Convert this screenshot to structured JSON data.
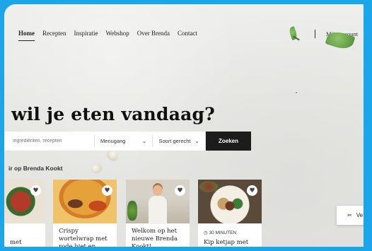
{
  "nav": {
    "items": [
      {
        "label": "Home",
        "active": true
      },
      {
        "label": "Recepten"
      },
      {
        "label": "Inspiratie"
      },
      {
        "label": "Webshop"
      },
      {
        "label": "Over Brenda"
      },
      {
        "label": "Contact"
      }
    ],
    "account_label": "Mijn account"
  },
  "hero": {
    "headline": "wil je eten vandaag?"
  },
  "search": {
    "placeholder": "ingrediënten, recepten",
    "course_label": "Menugang",
    "dish_type_label": "Soort gerecht",
    "submit_label": "Zoeken"
  },
  "section": {
    "title": "ir op Brenda Kookt"
  },
  "cards": [
    {
      "title": "met",
      "icon": "heart-icon"
    },
    {
      "title": "Crispy wortelwrap met rode biet en",
      "icon": "heart-icon"
    },
    {
      "title": "Welkom op het nieuwe Brenda Kookt!",
      "icon": "heart-icon"
    },
    {
      "meta": "30 MINUTEN",
      "title": "Kip ketjap met slirt en",
      "icon": "heart-icon"
    }
  ],
  "floating": {
    "label": "Ve",
    "icon": "utensils-icon"
  },
  "colors": {
    "frame": "#1aa6e8",
    "button_dark": "#1c1c1c",
    "background": "#e8e8e5"
  }
}
